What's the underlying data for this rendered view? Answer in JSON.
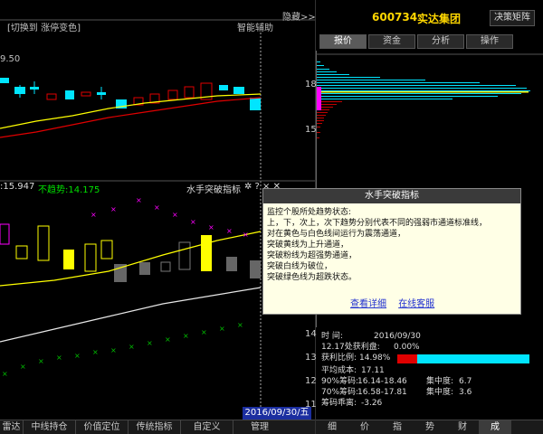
{
  "left": {
    "switch_label": "[切换到 涨停变色]",
    "smart_aid": "智能辅助",
    "hide_button": "隐藏>>",
    "price_label": "9.50",
    "indicator": {
      "val1": ":15.947",
      "val2": "不趋势:14.175",
      "name": "水手突破指标",
      "icons": "✲ ? × ✕"
    },
    "date_label": "2016/09/30/五",
    "bottom_tabs": [
      "雷达",
      "中线持仓",
      "价值定位",
      "传统指标",
      "自定义",
      "管理"
    ]
  },
  "right": {
    "stock_code": "600734",
    "stock_name": "实达集团",
    "decision_button": "决策矩阵",
    "tabs": [
      "报价",
      "资金",
      "分析",
      "操作"
    ],
    "axis": [
      "18",
      "15",
      "14",
      "13",
      "12",
      "11"
    ],
    "stats": {
      "time_label": "时    间:",
      "time_value": "2016/09/30",
      "profit_label": "12.17处获利盘:",
      "profit_value": "0.00%",
      "ratio_label": "获利比例:",
      "ratio_value": "14.98%",
      "avg_cost_label": "平均成本:",
      "avg_cost_value": "17.11",
      "chip90_label": "90%筹码:",
      "chip90_value": "16.14-18.46",
      "conc90_label": "集中度:",
      "conc90_value": "6.7",
      "chip70_label": "70%筹码:",
      "chip70_value": "16.58-17.81",
      "conc70_label": "集中度:",
      "conc70_value": "3.6",
      "dispersion_label": "筹码乖离:",
      "dispersion_value": "-3.26"
    },
    "bottom_tabs": [
      "细",
      "价",
      "指",
      "势",
      "财",
      "成"
    ]
  },
  "popup": {
    "title": "水手突破指标",
    "lines": [
      "监控个股所处趋势状态:",
      "上，下，次上，次下趋势分别代表不同的强弱市通道标准线，",
      "对在黄色与白色线间运行为震荡通道，",
      "突破黄线为上升通道，",
      "突破粉线为超强势通道，",
      "突破白线为破位，",
      "突破绿色线为超跌状态。"
    ],
    "link_detail": "查看详细",
    "link_service": "在线客服"
  },
  "colors": {
    "cyan": "#00e5ff",
    "yellow": "#ffff00",
    "red": "#e00000",
    "magenta": "#ff00ff",
    "green": "#00c000"
  }
}
